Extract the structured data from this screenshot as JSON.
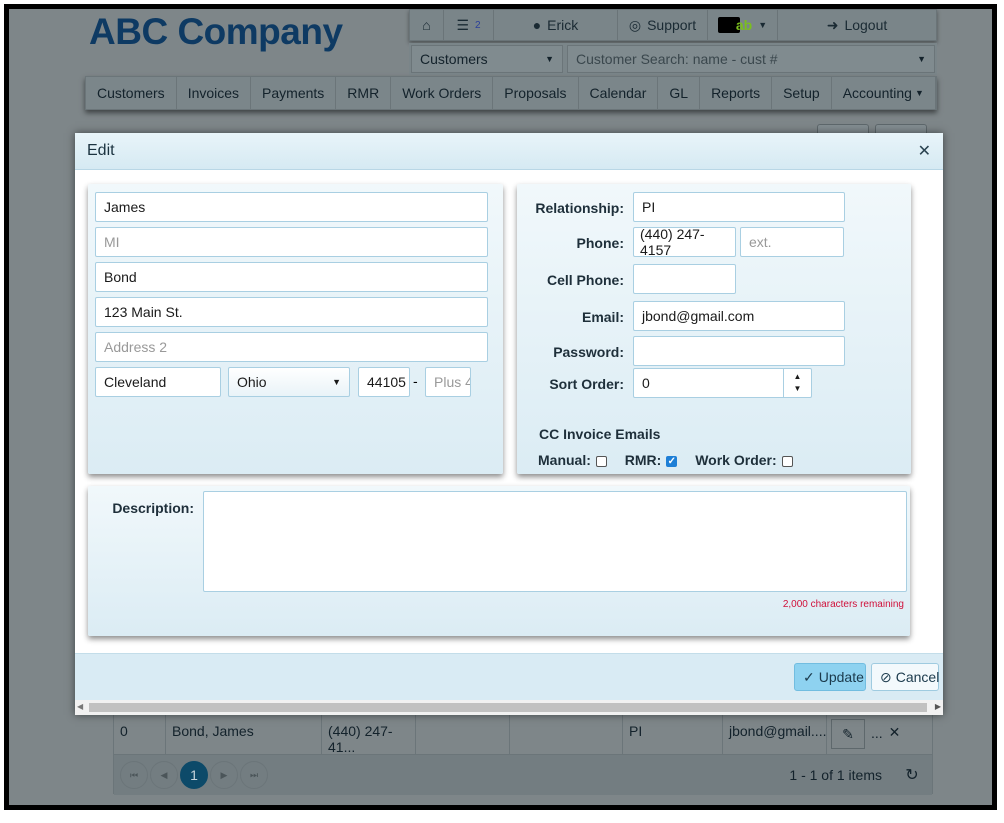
{
  "brand": {
    "name": "ABC Company"
  },
  "topbar": {
    "home_icon": "home-icon",
    "queue_badge": "2",
    "user": "Erick",
    "support": "Support",
    "logout": "Logout",
    "qb_logo": "ab"
  },
  "search": {
    "module": "Customers",
    "placeholder": "Customer Search: name - cust #"
  },
  "nav": [
    "Customers",
    "Invoices",
    "Payments",
    "RMR",
    "Work Orders",
    "Proposals",
    "Calendar",
    "GL",
    "Reports",
    "Setup",
    "Accounting"
  ],
  "modal": {
    "title": "Edit",
    "left": {
      "first_name": "James",
      "middle_placeholder": "MI",
      "last_name": "Bond",
      "address1": "123 Main St.",
      "address2_placeholder": "Address 2",
      "city": "Cleveland",
      "state": "Ohio",
      "zip": "44105",
      "zip_sep": "-",
      "plus4_placeholder": "Plus 4"
    },
    "right": {
      "relationship_label": "Relationship:",
      "relationship": "PI",
      "phone_label": "Phone:",
      "phone": "(440) 247-4157",
      "ext_placeholder": "ext.",
      "cell_label": "Cell Phone:",
      "cell": "",
      "email_label": "Email:",
      "email": "jbond@gmail.com",
      "password_label": "Password:",
      "password": "",
      "sort_label": "Sort Order:",
      "sort": "0",
      "cc_title": "CC Invoice Emails",
      "manual_label": "Manual:",
      "manual": false,
      "rmr_label": "RMR:",
      "rmr": true,
      "wo_label": "Work Order:",
      "wo": false
    },
    "description": {
      "label": "Description:",
      "value": "",
      "remaining": "2,000 characters remaining"
    },
    "update": "Update",
    "cancel": "Cancel"
  },
  "grid": {
    "row": [
      "0",
      "Bond, James",
      "(440) 247-41...",
      "",
      "",
      "PI",
      "jbond@gmail...."
    ],
    "delete_label": "...",
    "page": "1",
    "summary": "1 - 1 of 1 items"
  },
  "colors": {
    "accent": "#a9cfe2",
    "logo": "#0e3a63",
    "remaining": "#d0103a",
    "update_bg": "#8ed2f0"
  }
}
